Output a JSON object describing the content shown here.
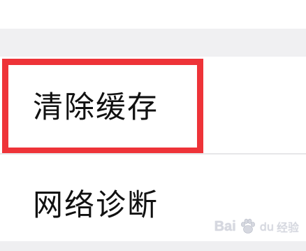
{
  "settings_list": {
    "items": [
      {
        "label": "清除缓存",
        "highlighted": true
      },
      {
        "label": "网络诊断",
        "highlighted": false
      }
    ]
  },
  "colors": {
    "highlight": "#ee3338",
    "section_gap": "#f0f0f2",
    "text": "#111111"
  },
  "watermark": {
    "brand": "Bai",
    "brand_suffix": "du",
    "sub": "经验",
    "icon": "paw-icon"
  }
}
